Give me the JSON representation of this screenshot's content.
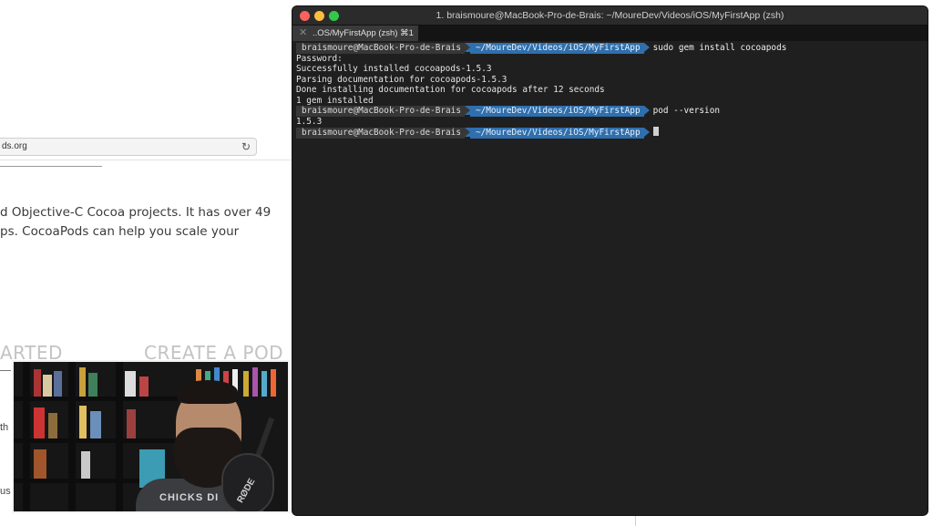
{
  "browser": {
    "url_text": "ds.org",
    "body_line_1": "d Objective-C Cocoa projects. It has over 49",
    "body_line_2": "ps. CocoaPods can help you scale your",
    "nav_started": "ARTED",
    "nav_create": "CREATE A POD",
    "fragment_th": "th",
    "fragment_us": "us"
  },
  "terminal": {
    "title": "1. braismoure@MacBook-Pro-de-Brais: ~/MoureDev/Videos/iOS/MyFirstApp (zsh)",
    "tab_label": "..OS/MyFirstApp (zsh)  ⌘1",
    "prompt_user": "braismoure@MacBook-Pro-de-Brais",
    "prompt_path": "~/MoureDev/Videos/iOS/MyFirstApp",
    "cmd_1": "sudo gem install cocoapods",
    "output_1": [
      "Password:",
      "Successfully installed cocoapods-1.5.3",
      "Parsing documentation for cocoapods-1.5.3",
      "Done installing documentation for cocoapods after 12 seconds",
      "1 gem installed"
    ],
    "cmd_2": "pod --version",
    "output_2": "1.5.3"
  },
  "webcam": {
    "shirt_text": "CHICKS DI",
    "mic_text": "RØDE"
  },
  "colors": {
    "terminal_bg": "#1f1f1f",
    "prompt_user_bg": "#373737",
    "prompt_path_bg": "#2f6fad",
    "traffic_close": "#fc605c",
    "traffic_min": "#fdbc40",
    "traffic_max": "#34c84a"
  },
  "icons": [
    "reload-icon",
    "tab-close-icon"
  ]
}
